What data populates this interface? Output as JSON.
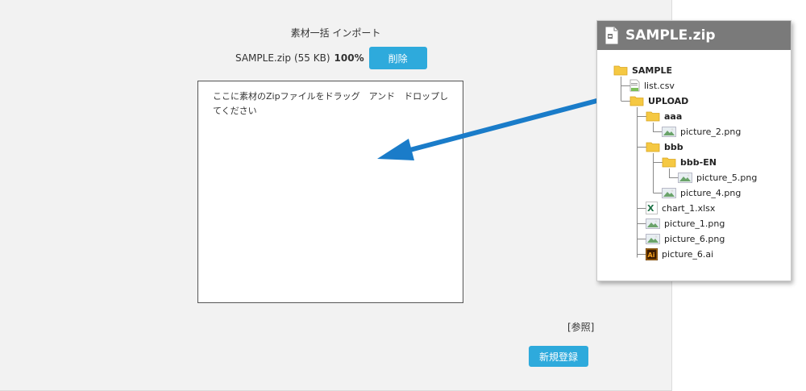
{
  "import_panel": {
    "title": "素材一括 インポート",
    "file_name": "SAMPLE.zip",
    "file_size": "(55 KB)",
    "progress_text": "100%",
    "progress": 1.0,
    "delete_label": "削除",
    "dropzone_text": "ここに素材のZipファイルをドラッグ　アンド　ドロップしてください",
    "browse_label": "[参照]",
    "register_label": "新規登録"
  },
  "zip_tree": {
    "title": "SAMPLE.zip",
    "nodes": [
      {
        "label": "SAMPLE",
        "icon": "folder-icon"
      },
      {
        "label": "list.csv",
        "icon": "csv-file-icon"
      },
      {
        "label": "UPLOAD",
        "icon": "folder-icon"
      },
      {
        "label": "aaa",
        "icon": "folder-icon"
      },
      {
        "label": "picture_2.png",
        "icon": "image-file-icon"
      },
      {
        "label": "bbb",
        "icon": "folder-icon"
      },
      {
        "label": "bbb-EN",
        "icon": "folder-icon"
      },
      {
        "label": "picture_5.png",
        "icon": "image-file-icon"
      },
      {
        "label": "picture_4.png",
        "icon": "image-file-icon"
      },
      {
        "label": "chart_1.xlsx",
        "icon": "excel-file-icon"
      },
      {
        "label": "picture_1.png",
        "icon": "image-file-icon"
      },
      {
        "label": "picture_6.png",
        "icon": "image-file-icon"
      },
      {
        "label": "picture_6.ai",
        "icon": "illustrator-file-icon"
      }
    ]
  },
  "colors": {
    "button": "#2eaadc",
    "arrow": "#1a7cc9",
    "panel_bg": "#f2f2f2",
    "tree_header": "#7a7a7a",
    "folder": "#f5c842"
  }
}
